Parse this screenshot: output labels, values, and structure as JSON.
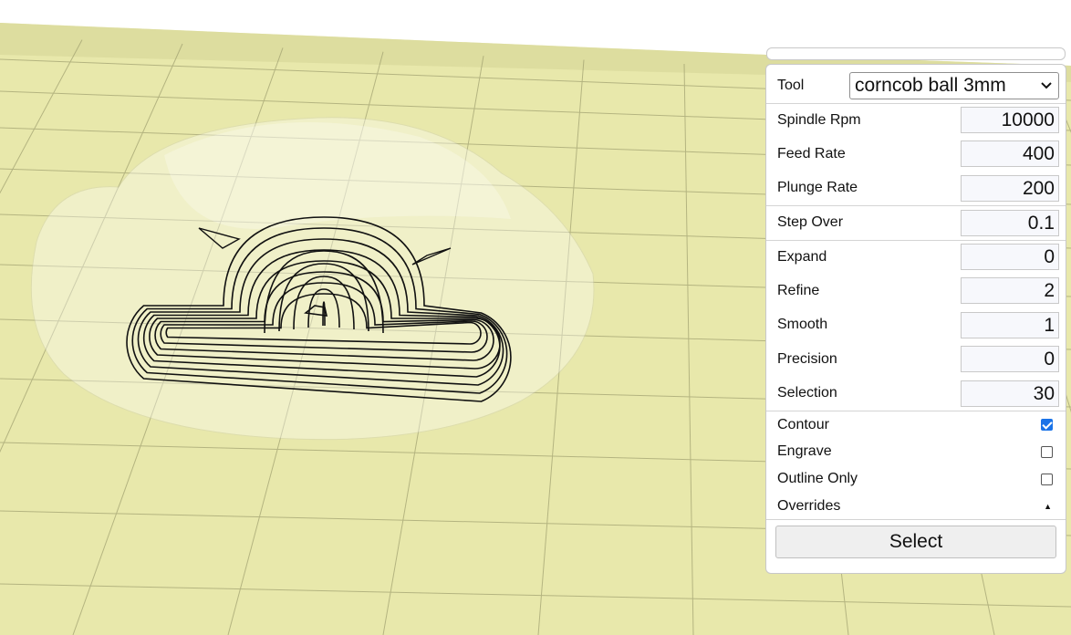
{
  "panel": {
    "tool": {
      "label": "Tool",
      "value": "corncob ball 3mm"
    },
    "spindle_rpm": {
      "label": "Spindle Rpm",
      "value": "10000"
    },
    "feed_rate": {
      "label": "Feed Rate",
      "value": "400"
    },
    "plunge_rate": {
      "label": "Plunge Rate",
      "value": "200"
    },
    "step_over": {
      "label": "Step Over",
      "value": "0.1"
    },
    "expand": {
      "label": "Expand",
      "value": "0"
    },
    "refine": {
      "label": "Refine",
      "value": "2"
    },
    "smooth": {
      "label": "Smooth",
      "value": "1"
    },
    "precision": {
      "label": "Precision",
      "value": "0"
    },
    "selection": {
      "label": "Selection",
      "value": "30"
    },
    "contour": {
      "label": "Contour",
      "checked": true
    },
    "engrave": {
      "label": "Engrave",
      "checked": false
    },
    "outline_only": {
      "label": "Outline Only",
      "checked": false
    },
    "overrides": {
      "label": "Overrides",
      "indicator": "▲"
    },
    "select_button": "Select"
  },
  "colors": {
    "bed": "#e7e7a8",
    "grid": "#9a9a6a",
    "toolpath": "#111111",
    "accent": "#1a73e8"
  }
}
